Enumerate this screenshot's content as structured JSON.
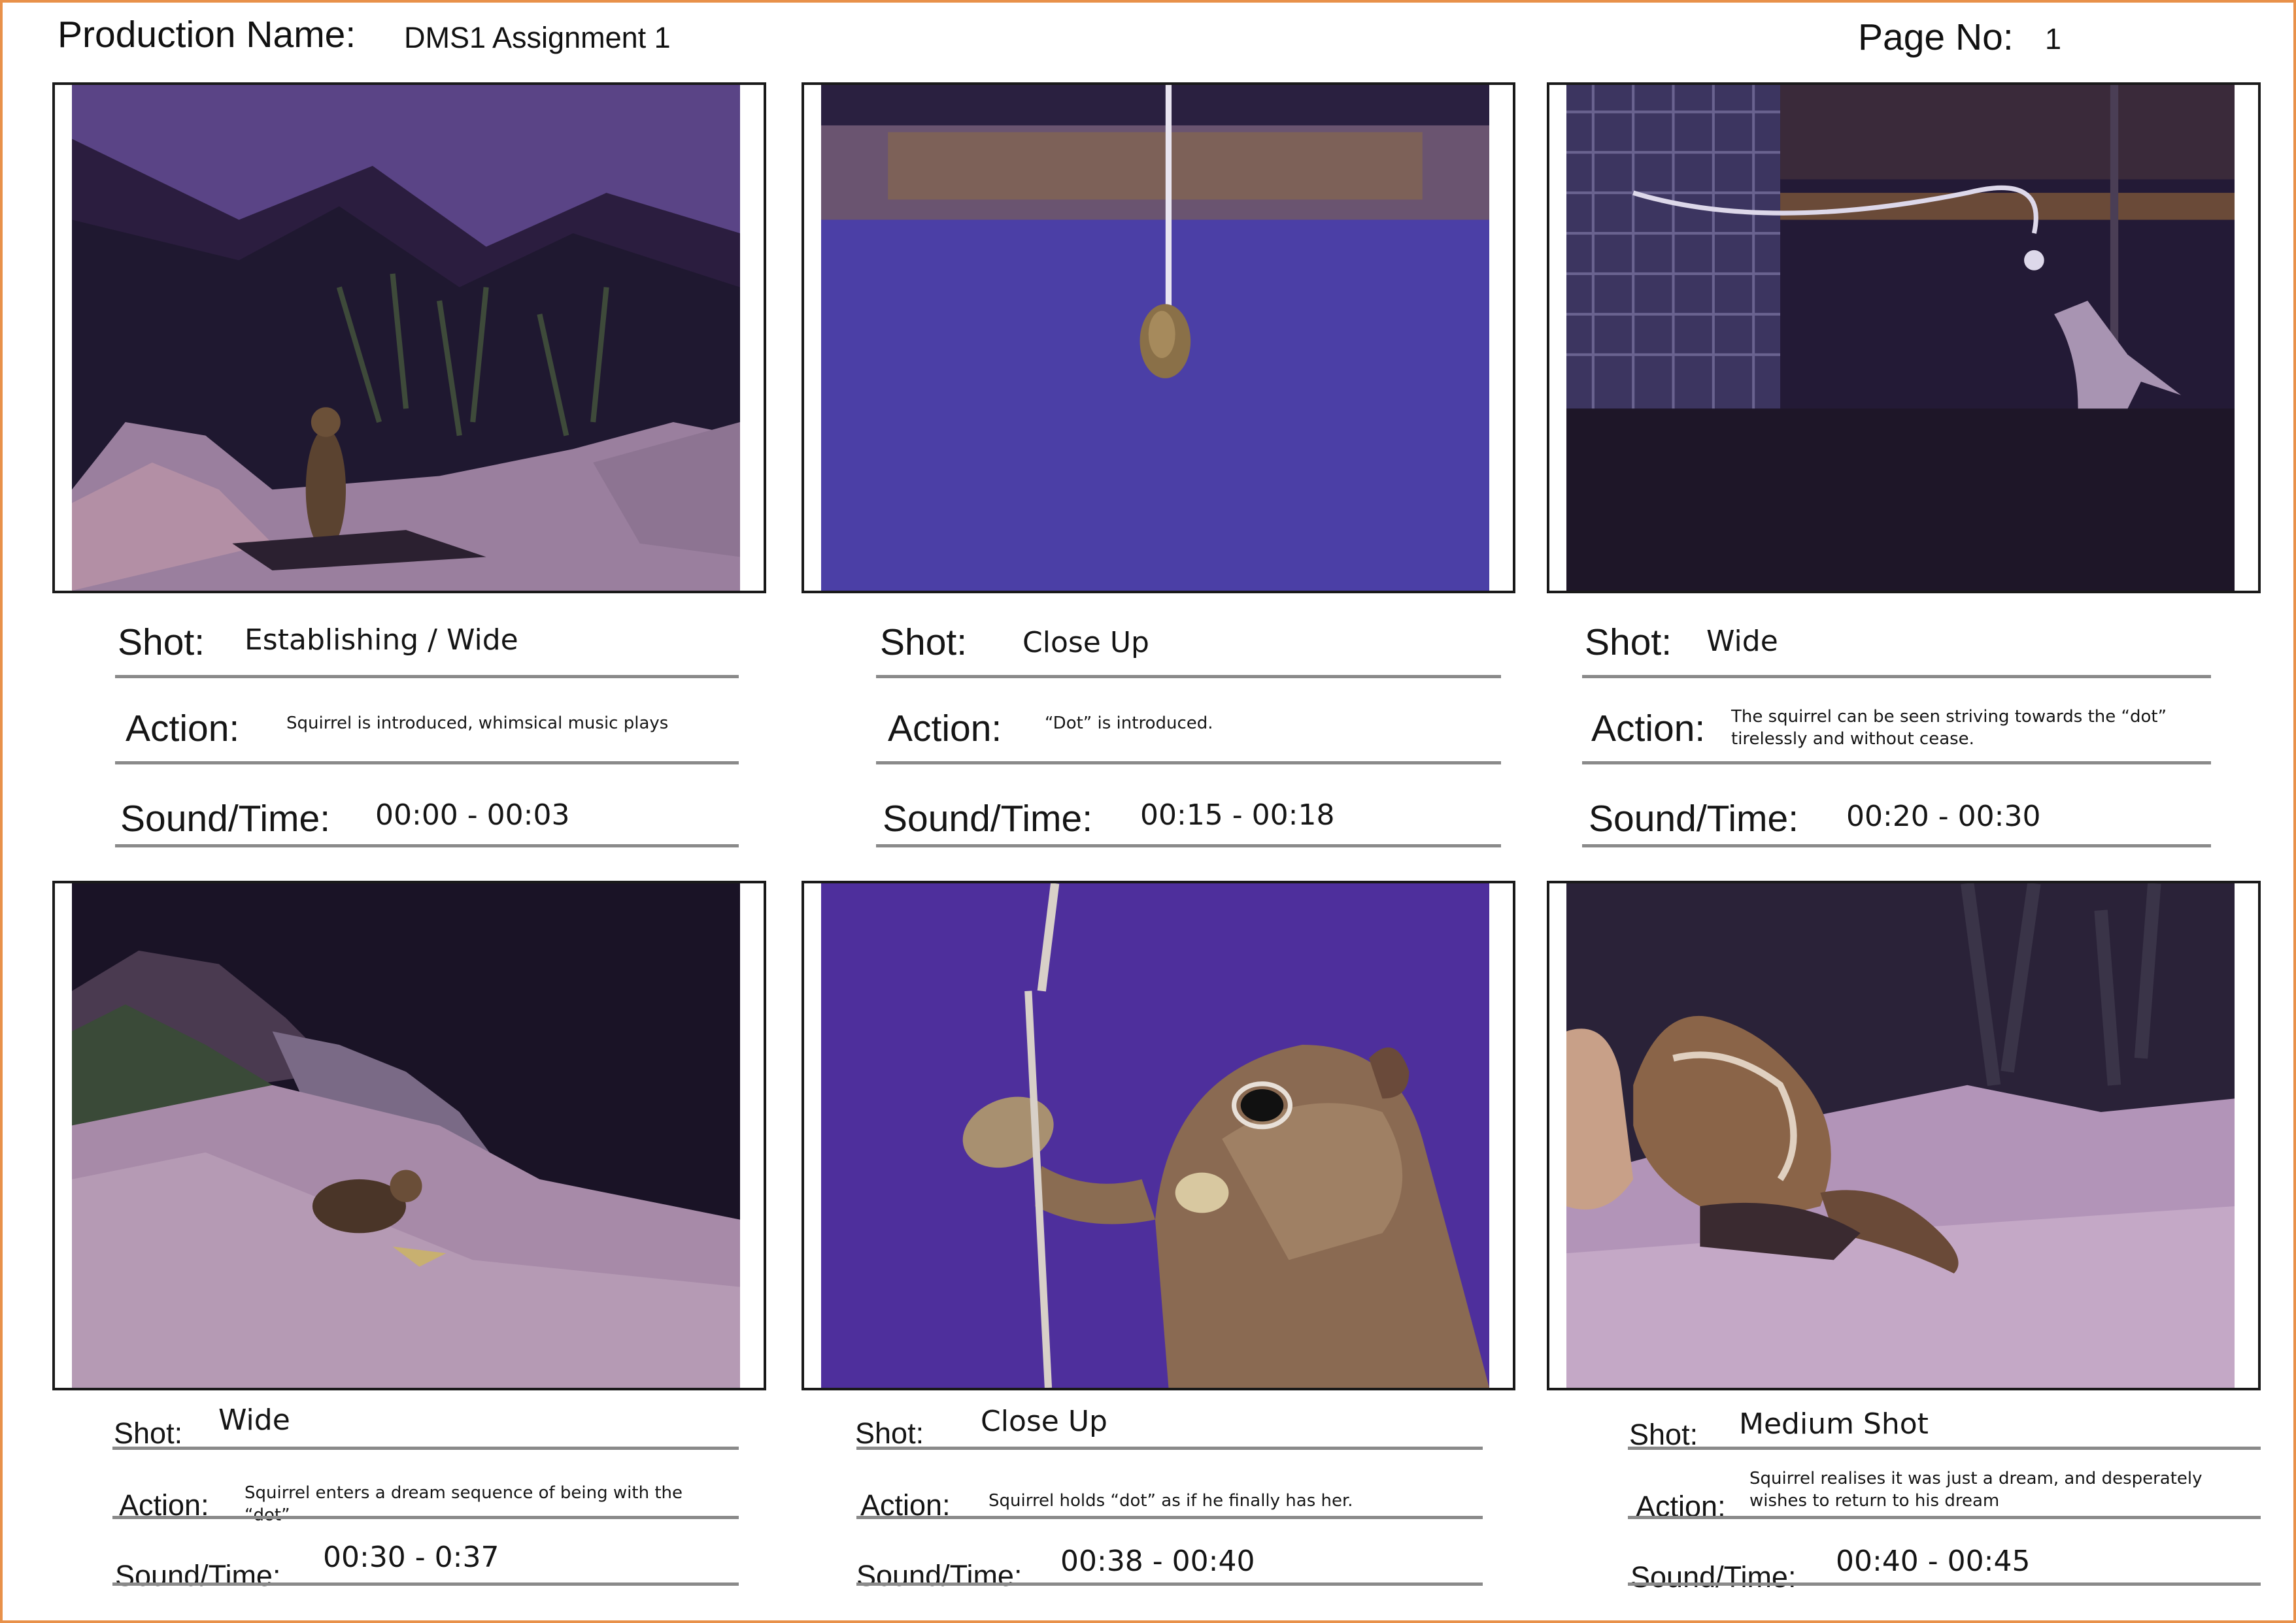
{
  "header": {
    "production_label": "Production Name:",
    "production_name": "DMS1 Assignment 1",
    "page_label": "Page No:",
    "page_number": "1"
  },
  "field_labels": {
    "shot": "Shot:",
    "action": "Action:",
    "sound_time": "Sound/Time:"
  },
  "panels": [
    {
      "image": "squirrel-standing-on-rock",
      "shot": "Establishing / Wide",
      "action": "Squirrel is introduced, whimsical music plays",
      "sound_time": "00:00 - 00:03"
    },
    {
      "image": "peanut-hanging-on-string",
      "shot": "Close Up",
      "action": "“Dot” is introduced.",
      "sound_time": "00:15 - 00:18"
    },
    {
      "image": "squirrel-jumping-at-string",
      "shot": "Wide",
      "action": "The squirrel can be seen striving towards the “dot” tirelessly and without cease.",
      "sound_time": "00:20 - 00:30"
    },
    {
      "image": "squirrel-eating-on-rock",
      "shot": "Wide",
      "action": "Squirrel enters a dream sequence of being with the “dot”",
      "sound_time": "00:30 - 0:37"
    },
    {
      "image": "squirrel-holding-peanut-closeup",
      "shot": "Close Up",
      "action": "Squirrel holds “dot” as if he finally has her.",
      "sound_time": "00:38 - 00:40"
    },
    {
      "image": "chipmunk-on-rock",
      "shot": "Medium Shot",
      "action": "Squirrel realises it was just a dream, and desperately wishes to return to his dream",
      "sound_time": "00:40 - 00:45"
    }
  ]
}
